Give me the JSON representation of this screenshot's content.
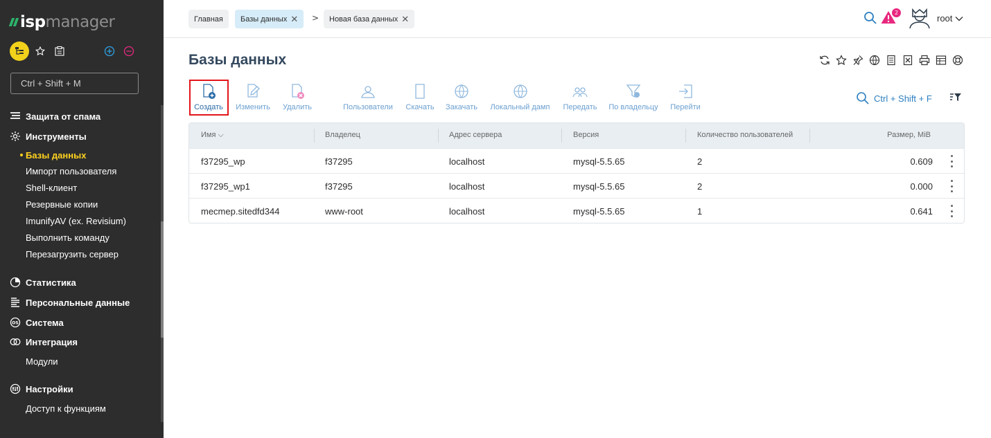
{
  "app": {
    "logo_isp": "isp",
    "logo_manager": "manager"
  },
  "sidebar": {
    "search_placeholder": "Ctrl + Shift + M",
    "groups": [
      {
        "label": "Защита от спама",
        "icon": "spam-shield-icon"
      },
      {
        "label": "Инструменты",
        "icon": "gear-icon"
      },
      {
        "label": "Статистика",
        "icon": "pie-chart-icon"
      },
      {
        "label": "Персональные данные",
        "icon": "personal-data-icon"
      },
      {
        "label": "Система",
        "icon": "os-icon"
      },
      {
        "label": "Интеграция",
        "icon": "integration-icon"
      },
      {
        "label": "Настройки",
        "icon": "settings-icon"
      }
    ],
    "tools_items": [
      {
        "label": "Базы данных",
        "active": true
      },
      {
        "label": "Импорт пользователя"
      },
      {
        "label": "Shell-клиент"
      },
      {
        "label": "Резервные копии"
      },
      {
        "label": "ImunifyAV (ex. Revisium)"
      },
      {
        "label": "Выполнить команду"
      },
      {
        "label": "Перезагрузить сервер"
      }
    ],
    "integration_items": [
      {
        "label": "Модули"
      }
    ],
    "settings_items": [
      {
        "label": "Доступ к функциям"
      }
    ]
  },
  "breadcrumbs": [
    {
      "label": "Главная"
    },
    {
      "label": "Базы данных",
      "closable": true
    },
    {
      "label": "Новая база данных",
      "closable": true
    }
  ],
  "topbar": {
    "notification_count": "2",
    "user_name": "root"
  },
  "page": {
    "title": "Базы данных"
  },
  "toolbar": [
    {
      "label": "Создать",
      "icon": "create-icon"
    },
    {
      "label": "Изменить",
      "icon": "edit-icon"
    },
    {
      "label": "Удалить",
      "icon": "delete-icon"
    },
    {
      "label": "Пользователи",
      "icon": "users-icon"
    },
    {
      "label": "Скачать",
      "icon": "download-icon"
    },
    {
      "label": "Закачать",
      "icon": "upload-icon"
    },
    {
      "label": "Локальный дамп",
      "icon": "local-dump-icon"
    },
    {
      "label": "Передать",
      "icon": "transfer-icon"
    },
    {
      "label": "По владельцу",
      "icon": "filter-owner-icon"
    },
    {
      "label": "Перейти",
      "icon": "goto-icon"
    }
  ],
  "filter": {
    "shortcut": "Ctrl + Shift + F"
  },
  "table": {
    "columns": [
      "Имя",
      "Владелец",
      "Адрес сервера",
      "Версия",
      "Количество пользователей",
      "Размер, MiB"
    ],
    "rows": [
      [
        "f37295_wp",
        "f37295",
        "localhost",
        "mysql-5.5.65",
        "2",
        "0.609"
      ],
      [
        "f37295_wp1",
        "f37295",
        "localhost",
        "mysql-5.5.65",
        "2",
        "0.000"
      ],
      [
        "mecmep.sitedfd344",
        "www-root",
        "localhost",
        "mysql-5.5.65",
        "1",
        "0.641"
      ]
    ]
  },
  "colors": {
    "sidebar_bg": "#2d2d2d",
    "accent_yellow": "#ffd21f",
    "link_blue": "#2d7fc1",
    "alert_pink": "#e8287f",
    "highlight_red": "#e3151a"
  }
}
